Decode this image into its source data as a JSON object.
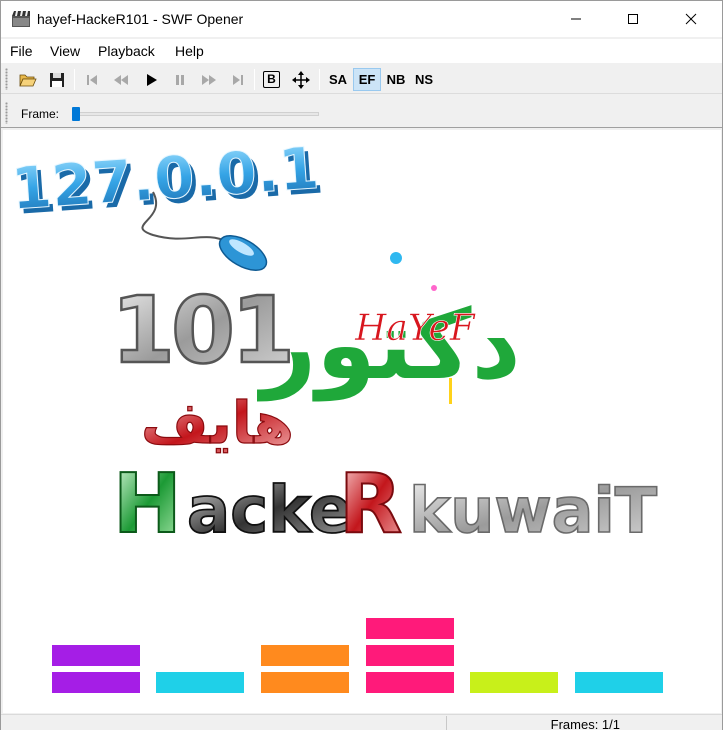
{
  "window": {
    "title": "hayef-HackeR101 - SWF Opener"
  },
  "menu": {
    "file": "File",
    "view": "View",
    "playback": "Playback",
    "help": "Help"
  },
  "toolbar": {
    "b_label": "B",
    "sa": "SA",
    "ef": "EF",
    "nb": "NB",
    "ns": "NS"
  },
  "frame": {
    "label": "Frame:",
    "position": 0
  },
  "stage": {
    "ip_text": "127.0.0.1",
    "number_text": "101",
    "arabic_line1": "دكتور",
    "hayef_text": "HaYeF",
    "arabic_line2": "هايف",
    "hacker_text": {
      "h": "H",
      "acke": "acke",
      "r": "R",
      "kuwait": "kuwaiT"
    }
  },
  "equalizer_colors": [
    "#a51ee6",
    "#1fd0e8",
    "#ff8a1e",
    "#ff1a7a",
    "#c8f01a",
    "#1fd0e8"
  ],
  "status": {
    "frames": "Frames: 1/1"
  },
  "colors": {
    "accent": "#0078d7",
    "ip_blue": "#3aa6e0",
    "arabic_green": "#1fa83a",
    "arabic_red": "#d8161e"
  }
}
